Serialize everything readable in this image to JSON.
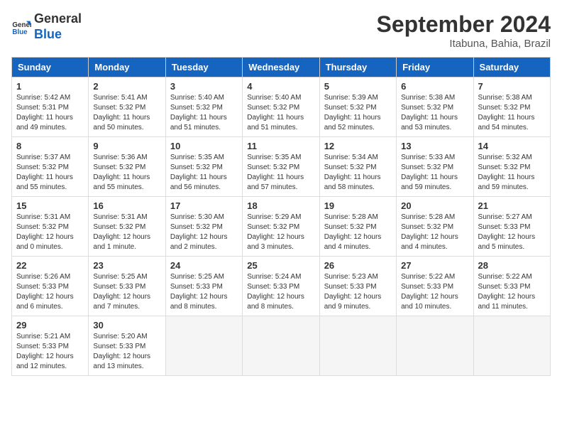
{
  "header": {
    "logo_line1": "General",
    "logo_line2": "Blue",
    "month_title": "September 2024",
    "location": "Itabuna, Bahia, Brazil"
  },
  "weekdays": [
    "Sunday",
    "Monday",
    "Tuesday",
    "Wednesday",
    "Thursday",
    "Friday",
    "Saturday"
  ],
  "weeks": [
    [
      {
        "day": "1",
        "info": "Sunrise: 5:42 AM\nSunset: 5:31 PM\nDaylight: 11 hours\nand 49 minutes."
      },
      {
        "day": "2",
        "info": "Sunrise: 5:41 AM\nSunset: 5:32 PM\nDaylight: 11 hours\nand 50 minutes."
      },
      {
        "day": "3",
        "info": "Sunrise: 5:40 AM\nSunset: 5:32 PM\nDaylight: 11 hours\nand 51 minutes."
      },
      {
        "day": "4",
        "info": "Sunrise: 5:40 AM\nSunset: 5:32 PM\nDaylight: 11 hours\nand 51 minutes."
      },
      {
        "day": "5",
        "info": "Sunrise: 5:39 AM\nSunset: 5:32 PM\nDaylight: 11 hours\nand 52 minutes."
      },
      {
        "day": "6",
        "info": "Sunrise: 5:38 AM\nSunset: 5:32 PM\nDaylight: 11 hours\nand 53 minutes."
      },
      {
        "day": "7",
        "info": "Sunrise: 5:38 AM\nSunset: 5:32 PM\nDaylight: 11 hours\nand 54 minutes."
      }
    ],
    [
      {
        "day": "8",
        "info": "Sunrise: 5:37 AM\nSunset: 5:32 PM\nDaylight: 11 hours\nand 55 minutes."
      },
      {
        "day": "9",
        "info": "Sunrise: 5:36 AM\nSunset: 5:32 PM\nDaylight: 11 hours\nand 55 minutes."
      },
      {
        "day": "10",
        "info": "Sunrise: 5:35 AM\nSunset: 5:32 PM\nDaylight: 11 hours\nand 56 minutes."
      },
      {
        "day": "11",
        "info": "Sunrise: 5:35 AM\nSunset: 5:32 PM\nDaylight: 11 hours\nand 57 minutes."
      },
      {
        "day": "12",
        "info": "Sunrise: 5:34 AM\nSunset: 5:32 PM\nDaylight: 11 hours\nand 58 minutes."
      },
      {
        "day": "13",
        "info": "Sunrise: 5:33 AM\nSunset: 5:32 PM\nDaylight: 11 hours\nand 59 minutes."
      },
      {
        "day": "14",
        "info": "Sunrise: 5:32 AM\nSunset: 5:32 PM\nDaylight: 11 hours\nand 59 minutes."
      }
    ],
    [
      {
        "day": "15",
        "info": "Sunrise: 5:31 AM\nSunset: 5:32 PM\nDaylight: 12 hours\nand 0 minutes."
      },
      {
        "day": "16",
        "info": "Sunrise: 5:31 AM\nSunset: 5:32 PM\nDaylight: 12 hours\nand 1 minute."
      },
      {
        "day": "17",
        "info": "Sunrise: 5:30 AM\nSunset: 5:32 PM\nDaylight: 12 hours\nand 2 minutes."
      },
      {
        "day": "18",
        "info": "Sunrise: 5:29 AM\nSunset: 5:32 PM\nDaylight: 12 hours\nand 3 minutes."
      },
      {
        "day": "19",
        "info": "Sunrise: 5:28 AM\nSunset: 5:32 PM\nDaylight: 12 hours\nand 4 minutes."
      },
      {
        "day": "20",
        "info": "Sunrise: 5:28 AM\nSunset: 5:32 PM\nDaylight: 12 hours\nand 4 minutes."
      },
      {
        "day": "21",
        "info": "Sunrise: 5:27 AM\nSunset: 5:33 PM\nDaylight: 12 hours\nand 5 minutes."
      }
    ],
    [
      {
        "day": "22",
        "info": "Sunrise: 5:26 AM\nSunset: 5:33 PM\nDaylight: 12 hours\nand 6 minutes."
      },
      {
        "day": "23",
        "info": "Sunrise: 5:25 AM\nSunset: 5:33 PM\nDaylight: 12 hours\nand 7 minutes."
      },
      {
        "day": "24",
        "info": "Sunrise: 5:25 AM\nSunset: 5:33 PM\nDaylight: 12 hours\nand 8 minutes."
      },
      {
        "day": "25",
        "info": "Sunrise: 5:24 AM\nSunset: 5:33 PM\nDaylight: 12 hours\nand 8 minutes."
      },
      {
        "day": "26",
        "info": "Sunrise: 5:23 AM\nSunset: 5:33 PM\nDaylight: 12 hours\nand 9 minutes."
      },
      {
        "day": "27",
        "info": "Sunrise: 5:22 AM\nSunset: 5:33 PM\nDaylight: 12 hours\nand 10 minutes."
      },
      {
        "day": "28",
        "info": "Sunrise: 5:22 AM\nSunset: 5:33 PM\nDaylight: 12 hours\nand 11 minutes."
      }
    ],
    [
      {
        "day": "29",
        "info": "Sunrise: 5:21 AM\nSunset: 5:33 PM\nDaylight: 12 hours\nand 12 minutes."
      },
      {
        "day": "30",
        "info": "Sunrise: 5:20 AM\nSunset: 5:33 PM\nDaylight: 12 hours\nand 13 minutes."
      },
      {
        "day": "",
        "info": ""
      },
      {
        "day": "",
        "info": ""
      },
      {
        "day": "",
        "info": ""
      },
      {
        "day": "",
        "info": ""
      },
      {
        "day": "",
        "info": ""
      }
    ]
  ]
}
